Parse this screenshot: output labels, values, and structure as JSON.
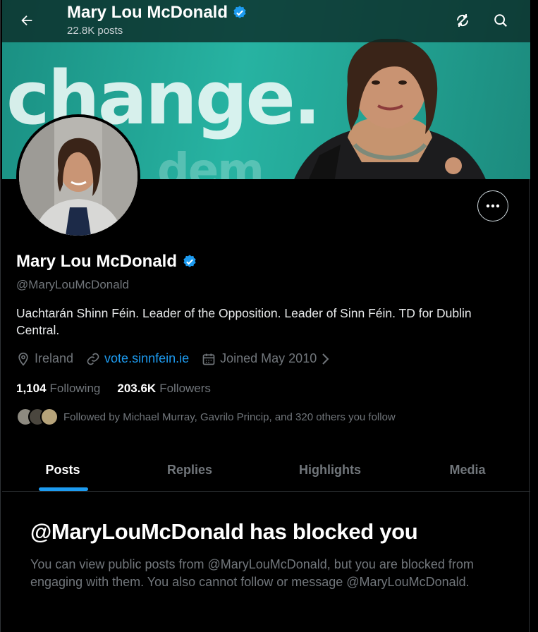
{
  "header": {
    "name": "Mary Lou McDonald",
    "posts": "22.8K posts"
  },
  "banner": {
    "word": "change.",
    "word2": "dem"
  },
  "profile": {
    "display_name": "Mary Lou McDonald",
    "handle": "@MaryLouMcDonald",
    "bio": "Uachtarán Shinn Féin. Leader of the Opposition. Leader of Sinn Féin. TD for Dublin Central.",
    "location": "Ireland",
    "website": "vote.sinnfein.ie",
    "joined": "Joined May 2010",
    "following_count": "1,104",
    "following_label": "Following",
    "followers_count": "203.6K",
    "followers_label": "Followers",
    "followed_by": "Followed by Michael Murray, Gavrilo Princip, and 320 others you follow"
  },
  "tabs": [
    {
      "label": "Posts",
      "active": true
    },
    {
      "label": "Replies",
      "active": false
    },
    {
      "label": "Highlights",
      "active": false
    },
    {
      "label": "Media",
      "active": false
    }
  ],
  "blocked": {
    "title": "@MaryLouMcDonald has blocked you",
    "text": "You can view public posts from @MaryLouMcDonald, but you are blocked from engaging with them. You also cannot follow or message @MaryLouMcDonald."
  },
  "colors": {
    "accent": "#1d9bf0",
    "verified": "#1d9bf0",
    "muted": "#71767b"
  }
}
